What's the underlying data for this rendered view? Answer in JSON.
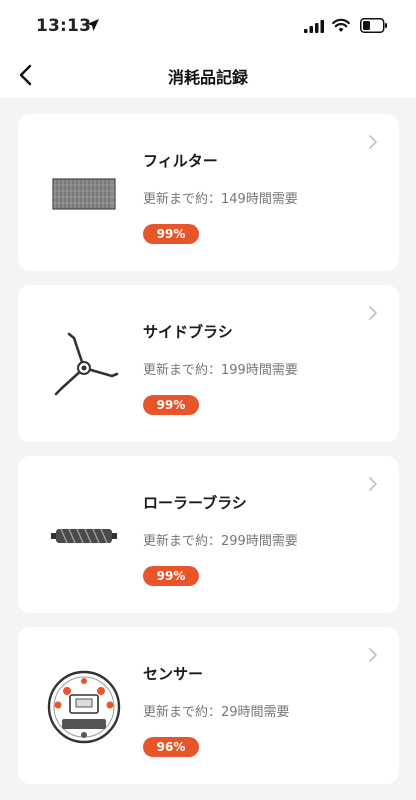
{
  "status_bar": {
    "time": "13:13"
  },
  "header": {
    "title": "消耗品記録",
    "back_icon": "chevron-left-icon"
  },
  "consumables": [
    {
      "name": "フィルター",
      "remaining": "更新まで約：149時間需要",
      "percent": "99%",
      "icon": "filter-icon"
    },
    {
      "name": "サイドブラシ",
      "remaining": "更新まで約：199時間需要",
      "percent": "99%",
      "icon": "side-brush-icon"
    },
    {
      "name": "ローラーブラシ",
      "remaining": "更新まで約：299時間需要",
      "percent": "99%",
      "icon": "roller-brush-icon"
    },
    {
      "name": "センサー",
      "remaining": "更新まで約：29時間需要",
      "percent": "96%",
      "icon": "sensor-icon"
    }
  ],
  "colors": {
    "accent": "#e8552a",
    "background": "#f4f4f4",
    "card": "#ffffff"
  }
}
